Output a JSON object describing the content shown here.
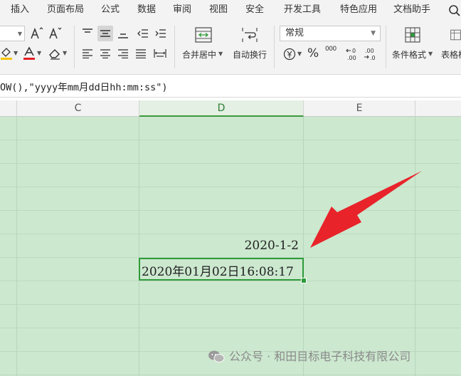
{
  "menu": {
    "items": [
      "插入",
      "页面布局",
      "公式",
      "数据",
      "审阅",
      "视图",
      "安全",
      "开发工具",
      "特色应用",
      "文档助手"
    ]
  },
  "ribbon": {
    "merge_center_label": "合并居中",
    "wrap_text_label": "自动换行",
    "number_format_value": "常规",
    "percent_symbol": "%",
    "thousands_symbol": "000",
    "increase_decimal_symbol": "+0 .00",
    "decrease_decimal_symbol": ".00 →.0",
    "conditional_format_label": "条件格式",
    "table_style_label": "表格样"
  },
  "formula_bar": {
    "text": "OW(),\"yyyy年mm月dd日hh:mm:ss\")"
  },
  "columns": {
    "headers": [
      "C",
      "D",
      "E"
    ],
    "active": "D"
  },
  "cells": {
    "d_date": "2020-1-2",
    "d_datetime": "2020年01月02日16:08:17"
  },
  "watermark": {
    "text": "公众号 · 和田目标电子科技有限公司"
  },
  "colors": {
    "grid_background": "#cce8cf",
    "selection_border": "#2e9b3a",
    "arrow": "#e8232a"
  }
}
